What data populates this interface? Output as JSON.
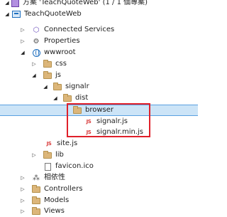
{
  "solution": {
    "label": "方案 'TeachQuoteWeb' (1 / 1 個專案)"
  },
  "tree": {
    "project": "TeachQuoteWeb",
    "connected_services": "Connected Services",
    "properties": "Properties",
    "wwwroot": "wwwroot",
    "css": "css",
    "js": "js",
    "signalr": "signalr",
    "dist": "dist",
    "browser": "browser",
    "signalr_js": "signalr.js",
    "signalr_min_js": "signalr.min.js",
    "site_js": "site.js",
    "lib": "lib",
    "favicon": "favicon.ico",
    "dependencies": "相依性",
    "controllers": "Controllers",
    "models": "Models",
    "views": "Views"
  },
  "icons": {
    "js_glyph": "JS",
    "wrench": "⚙",
    "connected": "⬡"
  },
  "colors": {
    "selection": "#cce4f7",
    "highlight": "#e0202a",
    "folder": "#dcb67a",
    "js": "#d83a3a"
  }
}
